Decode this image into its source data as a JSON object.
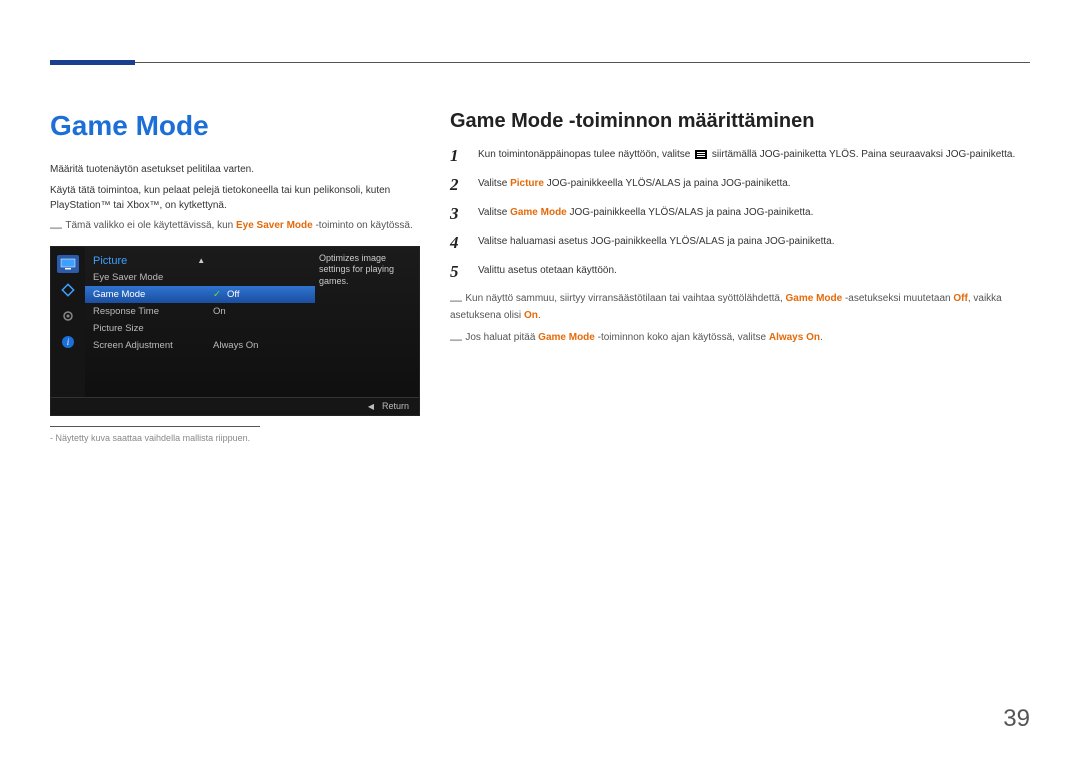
{
  "left": {
    "heading": "Game Mode",
    "p1": "Määritä tuotenäytön asetukset pelitilaa varten.",
    "p2": "Käytä tätä toimintoa, kun pelaat pelejä tietokoneella tai kun pelikonsoli, kuten PlayStation™ tai Xbox™, on kytkettynä.",
    "note1_pre": "Tämä valikko ei ole käytettävissä, kun ",
    "note1_bold": "Eye Saver Mode",
    "note1_post": " -toiminto on käytössä.",
    "footnote": "Näytetty kuva saattaa vaihdella mallista riippuen."
  },
  "osd": {
    "title": "Picture",
    "items": {
      "i0": "Eye Saver Mode",
      "i1": "Game Mode",
      "i2": "Response Time",
      "i3": "Picture Size",
      "i4": "Screen Adjustment"
    },
    "values": {
      "v0": "Off",
      "v1": "On",
      "v2": "Always On"
    },
    "desc": "Optimizes image settings for playing games.",
    "return": "Return"
  },
  "right": {
    "heading": "Game Mode -toiminnon määrittäminen",
    "step1_a": "Kun toimintonäppäinopas tulee näyttöön, valitse ",
    "step1_b": " siirtämällä JOG-painiketta YLÖS. Paina seuraavaksi JOG-painiketta.",
    "step2_a": "Valitse ",
    "step2_bold": "Picture",
    "step2_b": " JOG-painikkeella YLÖS/ALAS ja paina JOG-painiketta.",
    "step3_a": "Valitse ",
    "step3_bold": "Game Mode",
    "step3_b": " JOG-painikkeella YLÖS/ALAS ja paina JOG-painiketta.",
    "step4": "Valitse haluamasi asetus JOG-painikkeella YLÖS/ALAS ja paina JOG-painiketta.",
    "step5": "Valittu asetus otetaan käyttöön.",
    "note2_a": "Kun näyttö sammuu, siirtyy virransäästötilaan tai vaihtaa syöttölähdettä, ",
    "note2_b": "Game Mode",
    "note2_c": " -asetukseksi muutetaan ",
    "note2_d": "Off",
    "note2_e": ", vaikka asetuksena olisi ",
    "note2_f": "On",
    "note2_g": ".",
    "note3_a": "Jos haluat pitää ",
    "note3_b": "Game Mode",
    "note3_c": " -toiminnon koko ajan käytössä, valitse ",
    "note3_d": "Always On",
    "note3_e": "."
  },
  "page_number": "39",
  "step_nums": {
    "n1": "1",
    "n2": "2",
    "n3": "3",
    "n4": "4",
    "n5": "5"
  }
}
